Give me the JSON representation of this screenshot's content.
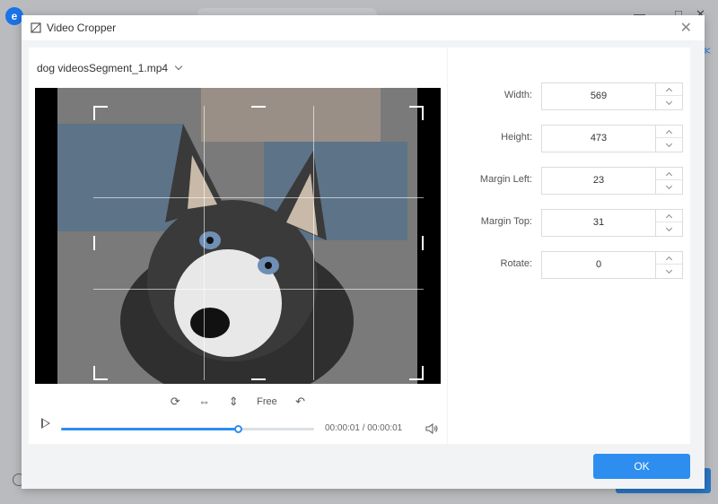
{
  "background": {
    "logo_letter": "e",
    "side_icon": "≪",
    "controls": [
      "—",
      "□",
      "✕"
    ]
  },
  "dialog": {
    "title": "Video Cropper",
    "close_icon": "✕",
    "file_name": "dog videosSegment_1.mp4",
    "tools": {
      "rotate_icon": "⟳",
      "flip_h_icon": "⇔",
      "flip_v_icon": "⇕",
      "ratio_label": "Free",
      "reset_icon": "↶"
    },
    "player": {
      "progress_fraction": 0.7,
      "time_display": "00:00:01 / 00:00:01"
    },
    "fields": [
      {
        "label": "Width:",
        "value": "569"
      },
      {
        "label": "Height:",
        "value": "473"
      },
      {
        "label": "Margin Left:",
        "value": "23"
      },
      {
        "label": "Margin Top:",
        "value": "31"
      },
      {
        "label": "Rotate:",
        "value": "0"
      }
    ],
    "ok_label": "OK"
  },
  "colors": {
    "accent": "#2d8ef0",
    "dialog_bg": "#f2f3f5"
  }
}
